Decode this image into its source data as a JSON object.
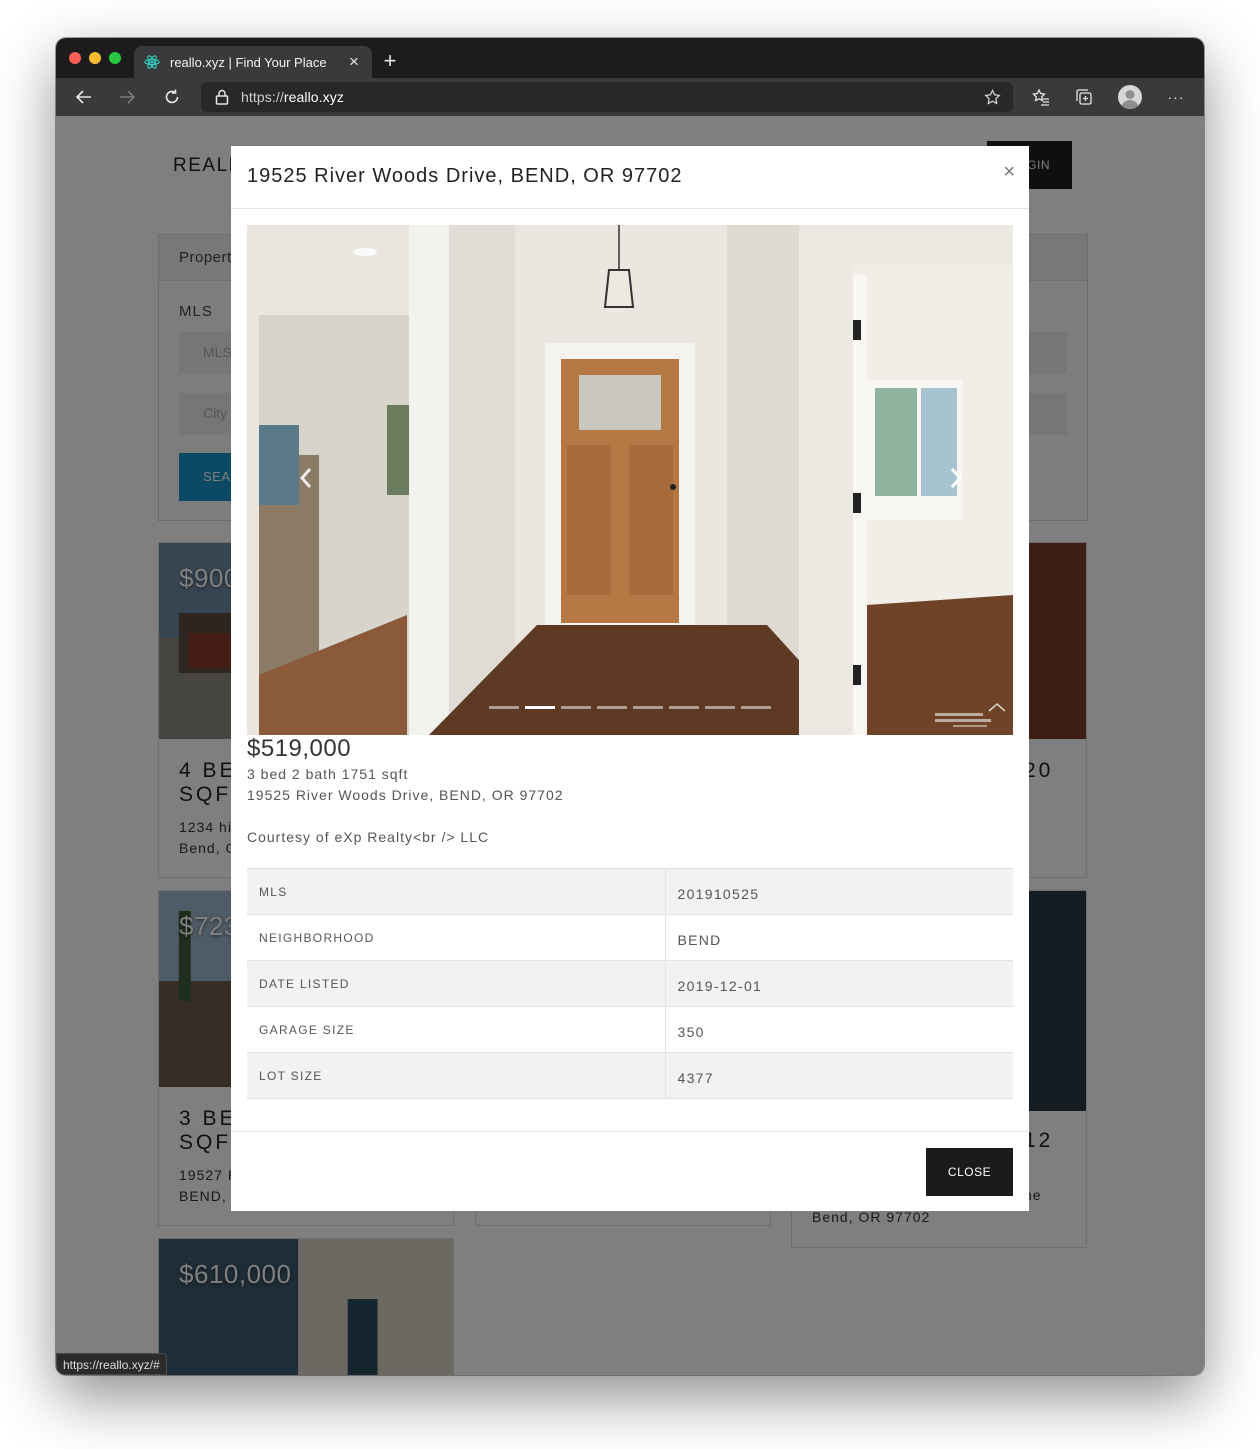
{
  "browser": {
    "tab_title": "reallo.xyz | Find Your Place",
    "tab_close": "×",
    "new_tab": "+",
    "url_scheme": "https://",
    "url_host": "reallo.xyz",
    "more_label": "···",
    "status_url": "https://reallo.xyz/#"
  },
  "site": {
    "logo": "REALLO",
    "login_label": "LOGIN",
    "search_tab": "Property Search",
    "mls_label": "MLS",
    "mls_placeholder": "MLS",
    "city_placeholder": "City",
    "search_button": "SEARCH",
    "cards": [
      {
        "price": "$900,000",
        "title": "4 BED 3 BATH 2560 SQFT",
        "line1": "1234 hidden",
        "line2": "Bend, OR 97702"
      },
      {
        "price": "$723,000",
        "title": "3 BED 2 BATH 1872 SQFT",
        "line1": "19527 River Woods Drive",
        "line2": "BEND, OR 97702"
      },
      {
        "price": "$610,000"
      },
      {
        "title_tail": "20"
      },
      {
        "title_tail": "12",
        "line1": "he",
        "line2": "Bend, OR 97702"
      }
    ]
  },
  "modal": {
    "title": "19525 River Woods Drive, BEND, OR 97702",
    "close_x": "×",
    "price": "$519,000",
    "summary": "3 bed 2 bath 1751 sqft",
    "address": "19525 River Woods Drive, BEND, OR 97702",
    "courtesy": "Courtesy of eXp Realty<br /> LLC",
    "carousel": {
      "slides": 8,
      "active": 2,
      "watermark": "Central Oregon Association of REALTORS"
    },
    "details": [
      {
        "label": "MLS",
        "value": "201910525"
      },
      {
        "label": "NEIGHBORHOOD",
        "value": "BEND"
      },
      {
        "label": "DATE LISTED",
        "value": "2019-12-01"
      },
      {
        "label": "GARAGE SIZE",
        "value": "350"
      },
      {
        "label": "LOT SIZE",
        "value": "4377"
      }
    ],
    "close_button": "CLOSE"
  },
  "colors": {
    "accent": "#1792c8",
    "modal_bg": "#ffffff",
    "button_dark": "#1b1b1b"
  }
}
